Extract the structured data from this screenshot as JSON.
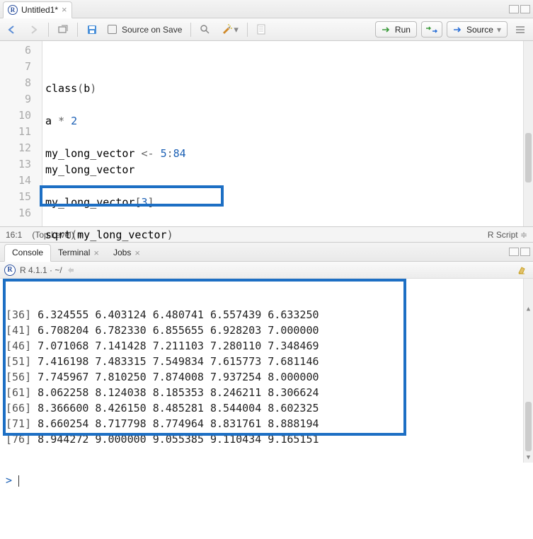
{
  "tabs": {
    "source_title": "Untitled1*"
  },
  "toolbar": {
    "source_on_save": "Source on Save",
    "run": "Run",
    "source": "Source"
  },
  "editor": {
    "lines": [
      {
        "n": 6,
        "html": "<span class='tok-fn'>class</span><span class='tok-paren'>(</span><span class='tok-id'>b</span><span class='tok-paren'>)</span>"
      },
      {
        "n": 7,
        "html": ""
      },
      {
        "n": 8,
        "html": "<span class='tok-id'>a</span> <span class='tok-op'>*</span> <span class='tok-num'>2</span>"
      },
      {
        "n": 9,
        "html": ""
      },
      {
        "n": 10,
        "html": "<span class='tok-id'>my_long_vector</span> <span class='tok-arrow'>&lt;-</span> <span class='tok-num'>5</span><span class='tok-op'>:</span><span class='tok-num'>84</span>"
      },
      {
        "n": 11,
        "html": "<span class='tok-id'>my_long_vector</span>"
      },
      {
        "n": 12,
        "html": ""
      },
      {
        "n": 13,
        "html": "<span class='tok-id'>my_long_vector</span><span class='tok-paren'>[</span><span class='tok-num'>3</span><span class='tok-paren'>]</span>"
      },
      {
        "n": 14,
        "html": ""
      },
      {
        "n": 15,
        "html": "<span class='tok-fn'>sqrt</span><span class='tok-paren'>(</span><span class='tok-id'>my_long_vector</span><span class='tok-paren'>)</span>"
      },
      {
        "n": 16,
        "html": ""
      }
    ]
  },
  "status": {
    "cursor": "16:1",
    "scope": "(Top Level)",
    "filetype": "R Script"
  },
  "console": {
    "tab_console": "Console",
    "tab_terminal": "Terminal",
    "tab_jobs": "Jobs",
    "session": "R 4.1.1 · ~/",
    "output": [
      {
        "idx": "[36]",
        "vals": "6.324555 6.403124 6.480741 6.557439 6.633250"
      },
      {
        "idx": "[41]",
        "vals": "6.708204 6.782330 6.855655 6.928203 7.000000"
      },
      {
        "idx": "[46]",
        "vals": "7.071068 7.141428 7.211103 7.280110 7.348469"
      },
      {
        "idx": "[51]",
        "vals": "7.416198 7.483315 7.549834 7.615773 7.681146"
      },
      {
        "idx": "[56]",
        "vals": "7.745967 7.810250 7.874008 7.937254 8.000000"
      },
      {
        "idx": "[61]",
        "vals": "8.062258 8.124038 8.185353 8.246211 8.306624"
      },
      {
        "idx": "[66]",
        "vals": "8.366600 8.426150 8.485281 8.544004 8.602325"
      },
      {
        "idx": "[71]",
        "vals": "8.660254 8.717798 8.774964 8.831761 8.888194"
      },
      {
        "idx": "[76]",
        "vals": "8.944272 9.000000 9.055385 9.110434 9.165151"
      }
    ],
    "prompt": ">"
  }
}
